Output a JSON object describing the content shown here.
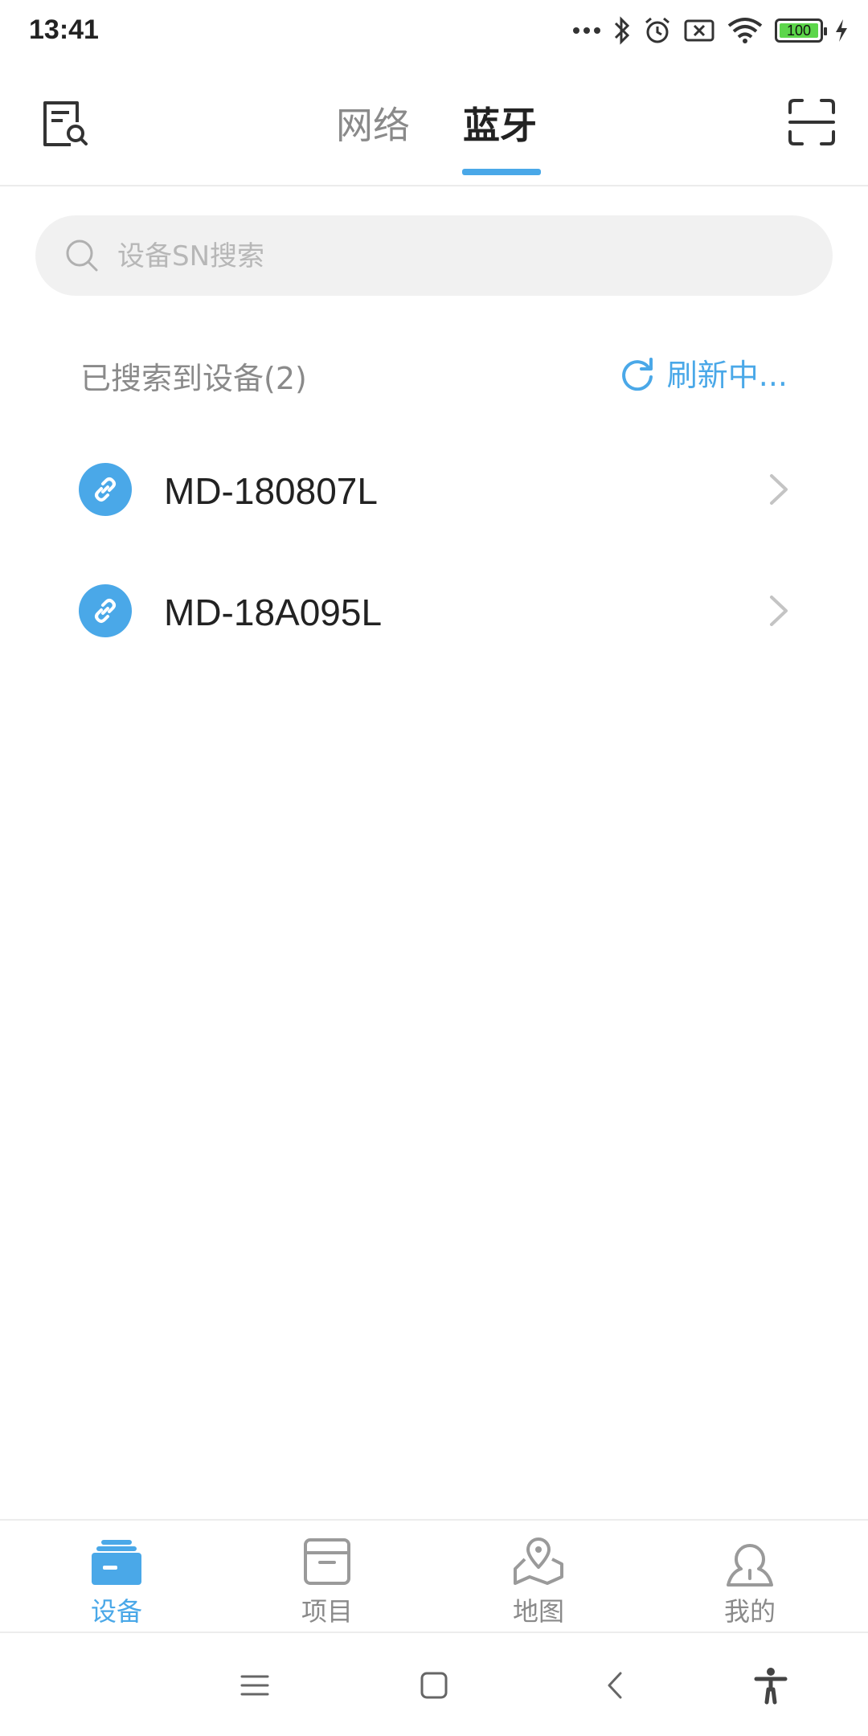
{
  "status_bar": {
    "time": "13:41",
    "battery": "100",
    "icons": [
      "more-dots-icon",
      "bluetooth-icon",
      "alarm-icon",
      "sim-x-icon",
      "wifi-icon",
      "battery-icon",
      "charging-icon"
    ]
  },
  "header": {
    "tabs": [
      {
        "label": "网络",
        "active": false
      },
      {
        "label": "蓝牙",
        "active": true
      }
    ],
    "left_icon": "search-document-icon",
    "right_icon": "scan-icon"
  },
  "search": {
    "placeholder": "设备SN搜索",
    "value": ""
  },
  "devices_section": {
    "found_label": "已搜索到设备(2)",
    "refresh_label": "刷新中..."
  },
  "devices": [
    {
      "name": "MD-180807L"
    },
    {
      "name": "MD-18A095L"
    }
  ],
  "bottom_nav": [
    {
      "label": "设备",
      "icon": "device-box-icon",
      "active": true
    },
    {
      "label": "项目",
      "icon": "project-archive-icon",
      "active": false
    },
    {
      "label": "地图",
      "icon": "map-pin-icon",
      "active": false
    },
    {
      "label": "我的",
      "icon": "profile-icon",
      "active": false
    }
  ],
  "colors": {
    "accent": "#4aa8e8",
    "text_primary": "#222222",
    "text_secondary": "#8a8a8a",
    "search_bg": "#f1f1f1"
  }
}
